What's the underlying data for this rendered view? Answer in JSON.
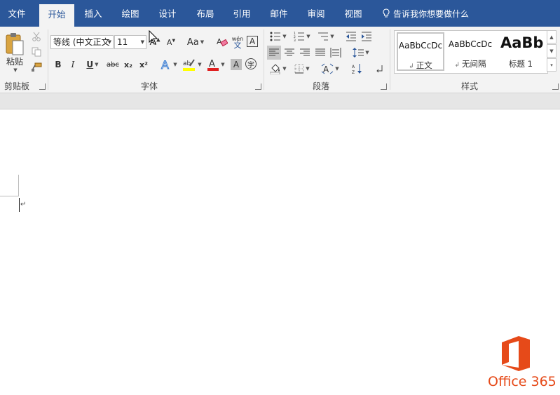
{
  "tabs": [
    {
      "label": "文件",
      "active": false
    },
    {
      "label": "开始",
      "active": true
    },
    {
      "label": "插入",
      "active": false
    },
    {
      "label": "绘图",
      "active": false
    },
    {
      "label": "设计",
      "active": false
    },
    {
      "label": "布局",
      "active": false
    },
    {
      "label": "引用",
      "active": false
    },
    {
      "label": "邮件",
      "active": false
    },
    {
      "label": "审阅",
      "active": false
    },
    {
      "label": "视图",
      "active": false
    }
  ],
  "tell_me": {
    "placeholder": "告诉我你想要做什么",
    "icon": "lightbulb-icon"
  },
  "clipboard": {
    "label": "剪贴板",
    "paste_label": "粘贴"
  },
  "font": {
    "label": "字体",
    "font_name": "等线 (中文正文",
    "font_size": "11",
    "change_case": "Aa",
    "phonetic_top": "wén",
    "phonetic_bottom": "文",
    "char_border": "A",
    "bold": "B",
    "italic": "I",
    "underline": "U",
    "strike": "abc",
    "subscript": "x₂",
    "superscript": "x²",
    "enclose": "字"
  },
  "paragraph": {
    "label": "段落"
  },
  "styles": {
    "label": "样式",
    "items": [
      {
        "sample": "AaBbCcDc",
        "name": "正文",
        "selected": true
      },
      {
        "sample": "AaBbCcDc",
        "name": "无间隔",
        "selected": false
      },
      {
        "sample": "AaBb",
        "name": "标题 1",
        "selected": false
      }
    ]
  },
  "document": {
    "paragraph_mark": "↵"
  },
  "branding": {
    "text": "Office 365"
  },
  "colors": {
    "accent": "#2b579a",
    "highlight": "#ffff00",
    "font_color": "#e02020",
    "office": "#e64a19"
  }
}
